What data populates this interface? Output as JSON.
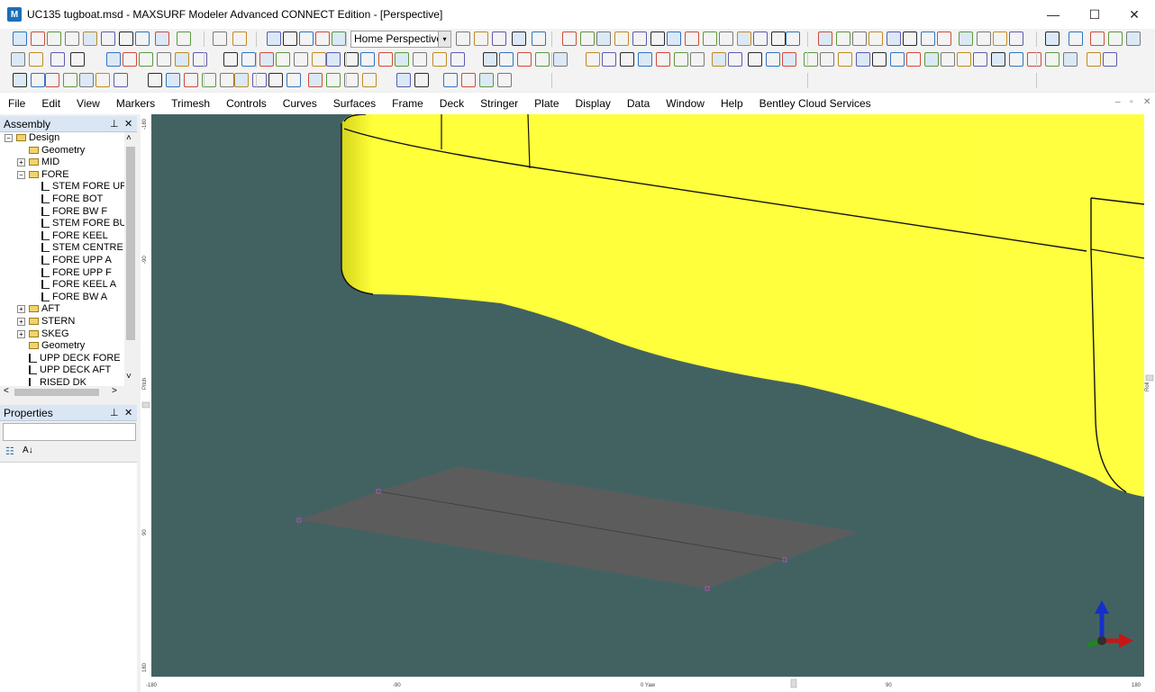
{
  "window": {
    "title": "UC135 tugboat.msd - MAXSURF Modeler Advanced CONNECT Edition - [Perspective]",
    "app_icon": "M",
    "minimize_glyph": "—",
    "maximize_glyph": "☐",
    "close_glyph": "✕"
  },
  "toolbar": {
    "view_select_value": "Home Perspective",
    "dropdown_glyph": "▾"
  },
  "menu": {
    "items": [
      "File",
      "Edit",
      "View",
      "Markers",
      "Trimesh",
      "Controls",
      "Curves",
      "Surfaces",
      "Frame",
      "Deck",
      "Stringer",
      "Plate",
      "Display",
      "Data",
      "Window",
      "Help",
      "Bentley Cloud Services"
    ],
    "mdi_minimize": "–",
    "mdi_restore": "▫",
    "mdi_close": "✕"
  },
  "assembly_panel": {
    "title": "Assembly",
    "pin": "📌",
    "close": "✕",
    "tree": [
      {
        "label": "Design",
        "type": "folder",
        "level": 0,
        "expander": "−"
      },
      {
        "label": "Geometry",
        "type": "folder",
        "level": 1,
        "expander": ""
      },
      {
        "label": "MID",
        "type": "folder",
        "level": 1,
        "expander": "+"
      },
      {
        "label": "FORE",
        "type": "folder",
        "level": 1,
        "expander": "−"
      },
      {
        "label": "STEM FORE UP",
        "type": "curve",
        "level": 2,
        "expander": ""
      },
      {
        "label": "FORE BOT",
        "type": "curve",
        "level": 2,
        "expander": ""
      },
      {
        "label": "FORE BW F",
        "type": "curve",
        "level": 2,
        "expander": ""
      },
      {
        "label": "STEM FORE BU",
        "type": "curve",
        "level": 2,
        "expander": ""
      },
      {
        "label": "FORE KEEL",
        "type": "curve",
        "level": 2,
        "expander": ""
      },
      {
        "label": "STEM CENTRE",
        "type": "curve",
        "level": 2,
        "expander": ""
      },
      {
        "label": "FORE UPP A",
        "type": "curve",
        "level": 2,
        "expander": ""
      },
      {
        "label": "FORE UPP F",
        "type": "curve",
        "level": 2,
        "expander": ""
      },
      {
        "label": "FORE KEEL A",
        "type": "curve",
        "level": 2,
        "expander": ""
      },
      {
        "label": "FORE BW A",
        "type": "curve",
        "level": 2,
        "expander": ""
      },
      {
        "label": "AFT",
        "type": "folder",
        "level": 1,
        "expander": "+"
      },
      {
        "label": "STERN",
        "type": "folder",
        "level": 1,
        "expander": "+"
      },
      {
        "label": "SKEG",
        "type": "folder",
        "level": 1,
        "expander": "+"
      },
      {
        "label": "Geometry",
        "type": "folder",
        "level": 1,
        "expander": ""
      },
      {
        "label": "UPP DECK FORE",
        "type": "curve",
        "level": 1,
        "expander": ""
      },
      {
        "label": "UPP DECK AFT",
        "type": "curve",
        "level": 1,
        "expander": ""
      },
      {
        "label": "RISED DK",
        "type": "curve",
        "level": 1,
        "expander": ""
      }
    ],
    "scroll_up": "˄",
    "scroll_down": "˅",
    "scroll_left": "<",
    "scroll_right": ">"
  },
  "properties_panel": {
    "title": "Properties",
    "pin": "📌",
    "close": "✕",
    "categorized_glyph": "☷",
    "sort_glyph": "A↓"
  },
  "viewport": {
    "background": "#426262",
    "hull_color": "#ffff3a",
    "plate_color": "#5c5c5c",
    "ruler_left_labels": [
      "-180",
      "-90",
      "Pitch",
      "90",
      "180"
    ],
    "ruler_right_labels": [
      "Roll"
    ],
    "ruler_bottom_labels": [
      "-180",
      "-90",
      "0 Yaw",
      "90",
      "180"
    ]
  }
}
